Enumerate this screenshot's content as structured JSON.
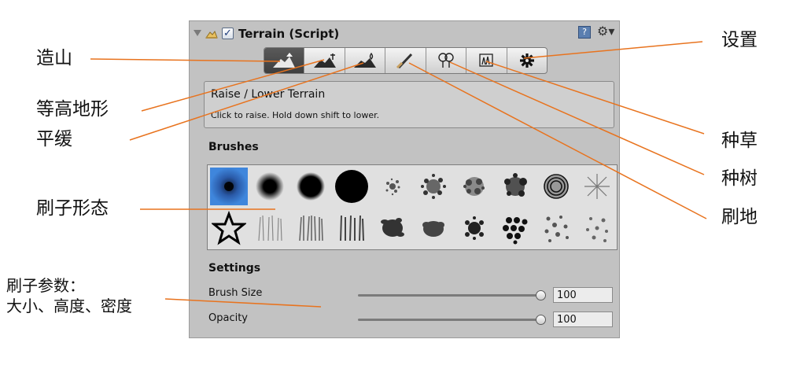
{
  "component": {
    "title": "Terrain (Script)",
    "enabled_mark": "✓",
    "help_glyph": "?",
    "settings_glyph": "⚙▾"
  },
  "toolbar": {
    "tools": [
      {
        "name": "raise-lower-terrain",
        "glyph": "▲",
        "active": true
      },
      {
        "name": "paint-height",
        "glyph": "▲"
      },
      {
        "name": "smooth-height",
        "glyph": "▲"
      },
      {
        "name": "paint-texture",
        "glyph": "✎"
      },
      {
        "name": "place-trees",
        "glyph": "♣"
      },
      {
        "name": "paint-details",
        "glyph": "✿"
      },
      {
        "name": "terrain-settings",
        "glyph": "✱"
      }
    ]
  },
  "description": {
    "title": "Raise / Lower Terrain",
    "subtitle": "Click to raise. Hold down shift to lower."
  },
  "brushes": {
    "label": "Brushes",
    "selected_index": 0,
    "items": [
      "soft-round-small",
      "soft-round-medium",
      "hard-round-medium",
      "hard-round-large",
      "splatter-1",
      "splatter-2",
      "splatter-3",
      "splatter-4",
      "rings",
      "star-burst",
      "star-outline",
      "grass-1",
      "grass-2",
      "grass-3",
      "leafy-1",
      "leafy-2",
      "speckle-1",
      "dots",
      "scatter-1",
      "scatter-2"
    ]
  },
  "settings": {
    "label": "Settings",
    "brush_size": {
      "label": "Brush Size",
      "value": "100",
      "fraction": 1.0
    },
    "opacity": {
      "label": "Opacity",
      "value": "100",
      "fraction": 1.0
    }
  },
  "annotations": {
    "raise_terrain": "造山",
    "paint_height": "等高地形",
    "smooth": "平缓",
    "brush_shape": "刷子形态",
    "brush_params_line1": "刷子参数：",
    "brush_params_line2": "大小、高度、密度",
    "settings": "设置",
    "paint_details": "种草",
    "place_trees": "种树",
    "paint_texture": "刷地"
  },
  "colors": {
    "annotation_line": "#e8731e",
    "panel_bg": "#c2c2c2",
    "selected_brush": "#3f86dc"
  }
}
